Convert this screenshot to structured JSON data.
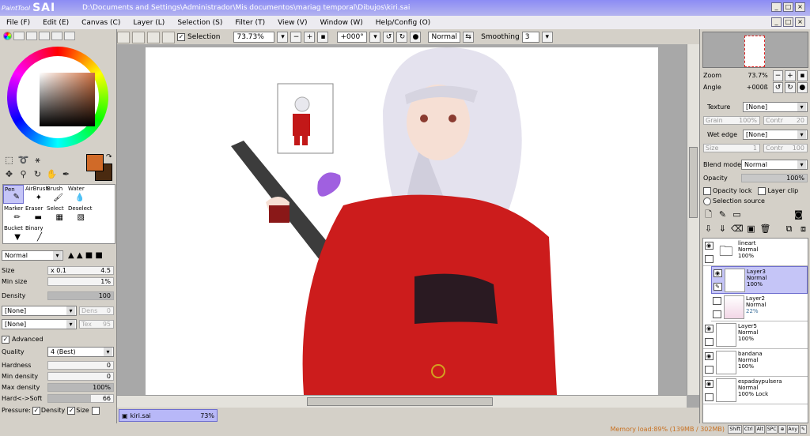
{
  "window": {
    "logo_small": "PaintTool",
    "logo_big": "SAI",
    "title_path": "D:\\Documents and Settings\\Administrador\\Mis documentos\\mariag temporal\\Dibujos\\kiri.sai"
  },
  "menu": [
    "File (F)",
    "Edit (E)",
    "Canvas (C)",
    "Layer (L)",
    "Selection (S)",
    "Filter (T)",
    "View (V)",
    "Window (W)",
    "Help/Config (O)"
  ],
  "toolbar": {
    "selection_label": "Selection",
    "selection_checked": true,
    "zoom": "73.73%",
    "rotation": "+000°",
    "blend_mode": "Normal",
    "smoothing_label": "Smoothing",
    "smoothing_value": "3"
  },
  "colors": {
    "primary": "#d06a28",
    "secondary": "#4a2a10",
    "accent": "#c5c5f7",
    "memory": "#c87020"
  },
  "brushes": [
    {
      "label": "Pen",
      "icon": "✎"
    },
    {
      "label": "AirBrush",
      "icon": "✦"
    },
    {
      "label": "Brush",
      "icon": "🖌"
    },
    {
      "label": "Water",
      "icon": "💧"
    },
    {
      "label": "",
      "icon": ""
    },
    {
      "label": "Marker",
      "icon": "✏"
    },
    {
      "label": "Eraser",
      "icon": "▬"
    },
    {
      "label": "Select",
      "icon": "▦"
    },
    {
      "label": "Deselect",
      "icon": "▧"
    },
    {
      "label": "",
      "icon": ""
    },
    {
      "label": "Bucket",
      "icon": "▼"
    },
    {
      "label": "Binary",
      "icon": "╱"
    },
    {
      "label": "",
      "icon": ""
    },
    {
      "label": "",
      "icon": ""
    },
    {
      "label": "",
      "icon": ""
    }
  ],
  "brush_props": {
    "mode": "Normal",
    "size_label": "Size",
    "size_mult": "x 0.1",
    "size_value": "4.5",
    "min_size_label": "Min size",
    "min_size_value": "1%",
    "density_label": "Density",
    "density_value": "100",
    "paper1": "[None]",
    "paper1_label": "Dens",
    "paper1_value": "0",
    "paper2": "[None]",
    "paper2_label": "Tex",
    "paper2_value": "95",
    "advanced_label": "Advanced",
    "quality_label": "Quality",
    "quality_value": "4 (Best)",
    "hardness_label": "Hardness",
    "hardness_value": "0",
    "min_density_label": "Min density",
    "min_density_value": "0",
    "max_density_label": "Max density",
    "max_density_value": "100%",
    "hard_soft_label": "Hard<->Soft",
    "hard_soft_value": "66",
    "pressure_label": "Pressure:",
    "pressure_density": "Density",
    "pressure_size": "Size"
  },
  "navigator": {
    "zoom_label": "Zoom",
    "zoom_value": "73.7%",
    "angle_label": "Angle",
    "angle_value": "+000ß"
  },
  "layer_props": {
    "texture_label": "Texture",
    "texture_value": "[None]",
    "grain_label": "Grain",
    "grain_value": "100%",
    "contr_label": "Contr",
    "contr_value": "20",
    "wet_label": "Wet edge",
    "wet_value": "[None]",
    "size_label": "Size",
    "size_value": "1",
    "contr2_value": "100",
    "blend_label": "Blend mode",
    "blend_value": "Normal",
    "opacity_label": "Opacity",
    "opacity_value": "100%",
    "opacity_lock": "Opacity lock",
    "layer_clip": "Layer clip",
    "selection_source": "Selection source"
  },
  "layers": [
    {
      "name": "lineart",
      "mode": "Normal",
      "opacity": "100%",
      "folder": true,
      "visible": true,
      "selected": false,
      "indent": false
    },
    {
      "name": "Layer3",
      "mode": "Normal",
      "opacity": "100%",
      "folder": false,
      "visible": true,
      "selected": true,
      "indent": true
    },
    {
      "name": "Layer2",
      "mode": "Normal",
      "opacity": "22%",
      "folder": false,
      "visible": false,
      "selected": false,
      "indent": true
    },
    {
      "name": "Layer5",
      "mode": "Normal",
      "opacity": "100%",
      "folder": false,
      "visible": true,
      "selected": false,
      "indent": false
    },
    {
      "name": "bandana",
      "mode": "Normal",
      "opacity": "100%",
      "folder": false,
      "visible": true,
      "selected": false,
      "indent": false
    },
    {
      "name": "espadaypulsera",
      "mode": "Normal",
      "opacity": "100% Lock",
      "folder": false,
      "visible": true,
      "selected": false,
      "indent": false
    }
  ],
  "document": {
    "name": "kiri.sai",
    "zoom": "73%"
  },
  "status": {
    "memory": "Memory load:89% (139MB / 302MB)",
    "keys": [
      "Shift",
      "Ctrl",
      "Alt",
      "SPC",
      "⊕",
      "Any",
      "✎"
    ]
  }
}
